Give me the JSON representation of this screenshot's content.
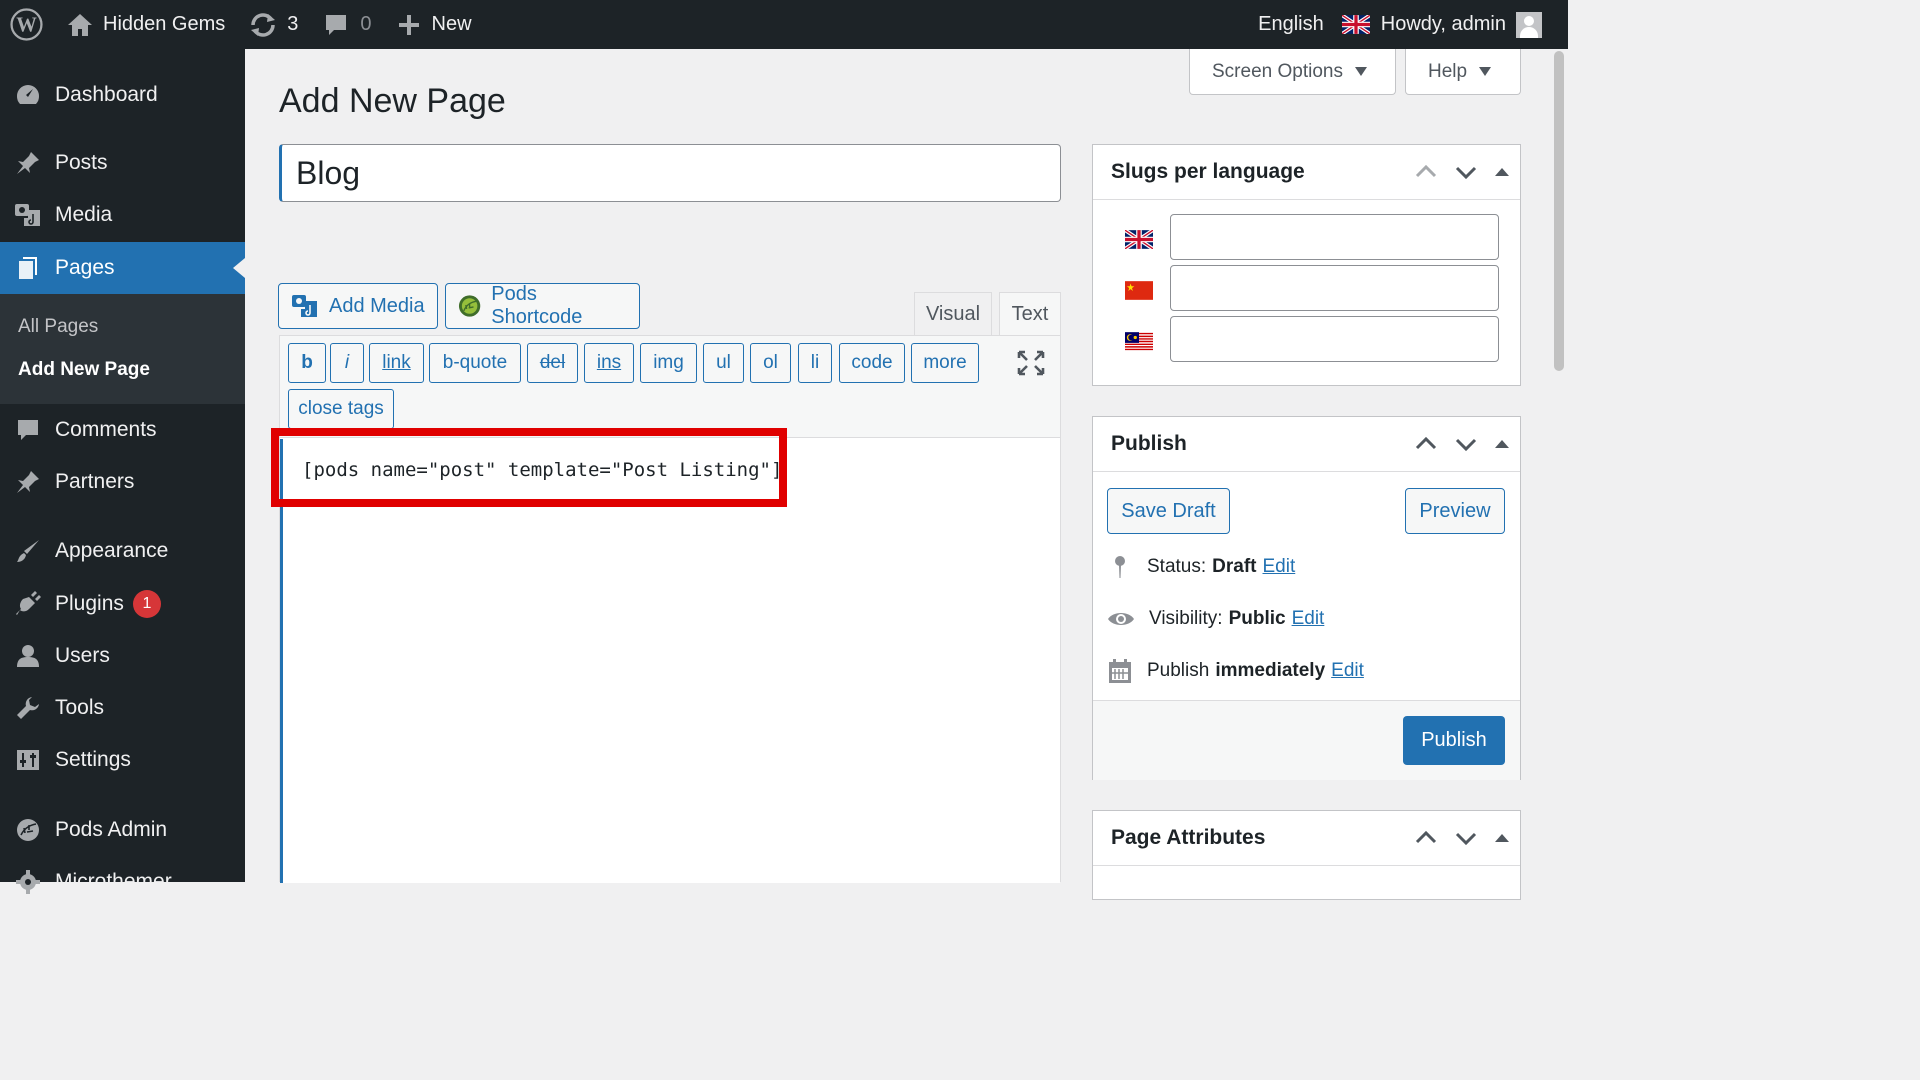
{
  "adminbar": {
    "site_name": "Hidden Gems",
    "updates_count": "3",
    "comments_count": "0",
    "new_label": "New",
    "language": "English",
    "howdy": "Howdy, admin"
  },
  "sidebar": {
    "items": [
      {
        "label": "Dashboard",
        "icon": "dashboard-icon"
      },
      {
        "label": "Posts",
        "icon": "pin-icon"
      },
      {
        "label": "Media",
        "icon": "media-icon"
      },
      {
        "label": "Pages",
        "icon": "pages-icon"
      },
      {
        "label": "Comments",
        "icon": "comment-icon"
      },
      {
        "label": "Partners",
        "icon": "pin-icon"
      },
      {
        "label": "Appearance",
        "icon": "brush-icon"
      },
      {
        "label": "Plugins",
        "icon": "plugin-icon"
      },
      {
        "label": "Users",
        "icon": "user-icon"
      },
      {
        "label": "Tools",
        "icon": "wrench-icon"
      },
      {
        "label": "Settings",
        "icon": "settings-icon"
      },
      {
        "label": "Pods Admin",
        "icon": "pods-icon"
      },
      {
        "label": "Microthemer",
        "icon": "gear-icon"
      }
    ],
    "submenu": [
      "All Pages",
      "Add New Page"
    ],
    "plugins_badge": "1"
  },
  "header": {
    "title": "Add New Page",
    "screen_options": "Screen Options",
    "help": "Help"
  },
  "editor": {
    "post_title": "Blog",
    "add_media": "Add Media",
    "pods_shortcode": "Pods Shortcode",
    "tab_visual": "Visual",
    "tab_text": "Text",
    "quicktags": [
      "b",
      "i",
      "link",
      "b-quote",
      "del",
      "ins",
      "img",
      "ul",
      "ol",
      "li",
      "code",
      "more",
      "close tags"
    ],
    "content": "[pods name=\"post\" template=\"Post Listing\"]"
  },
  "slugs_panel": {
    "title": "Slugs per language",
    "languages": [
      "English (UK flag)",
      "Chinese (China flag)",
      "Malay (Malaysia flag)"
    ]
  },
  "publish_panel": {
    "title": "Publish",
    "save_draft": "Save Draft",
    "preview": "Preview",
    "status_label": "Status:",
    "status_value": "Draft",
    "visibility_label": "Visibility:",
    "visibility_value": "Public",
    "publish_label": "Publish",
    "publish_value": "immediately",
    "edit_link": "Edit",
    "publish_button": "Publish"
  },
  "attributes_panel": {
    "title": "Page Attributes"
  },
  "colors": {
    "accent": "#2271b1",
    "adminbar_bg": "#1d2327",
    "highlight": "#e00000",
    "badge": "#d63638"
  }
}
